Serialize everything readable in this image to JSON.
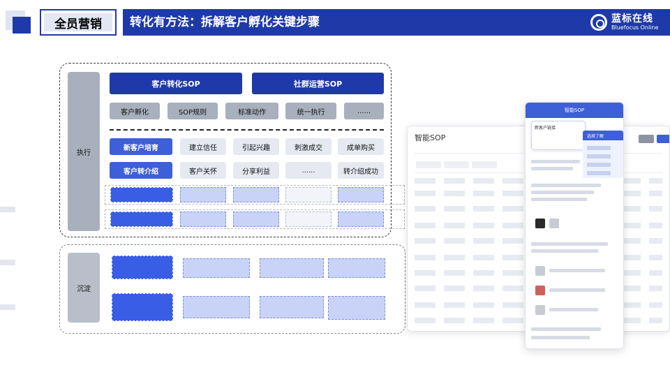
{
  "header": {
    "tag": "全员营销",
    "title": "转化有方法：拆解客户孵化关键步骤",
    "logo_cn": "蓝标在线",
    "logo_en": "Bluefocus Online"
  },
  "framework": {
    "exec_label": "执行",
    "stay_label": "沉淀",
    "top_blocks": [
      "客户转化SOP",
      "社群运营SOP"
    ],
    "tags": [
      "客户孵化",
      "SOP规则",
      "标准动作",
      "统一执行",
      "......"
    ],
    "row1": {
      "head": "新客户培育",
      "items": [
        "建立信任",
        "引起兴趣",
        "刺激成交",
        "成单购买"
      ]
    },
    "row2": {
      "head": "客户转介绍",
      "items": [
        "客户关怀",
        "分享利益",
        "......",
        "转介绍成功"
      ]
    }
  },
  "mockup": {
    "title": "智能SOP",
    "phone_title": "智能SOP",
    "phone_popup": "新客户链接",
    "phone_menu_head": "选择了解"
  },
  "colors": {
    "brand": "#1e3aa8",
    "accent": "#3d5fd8",
    "gray": "#a8b0bd"
  }
}
